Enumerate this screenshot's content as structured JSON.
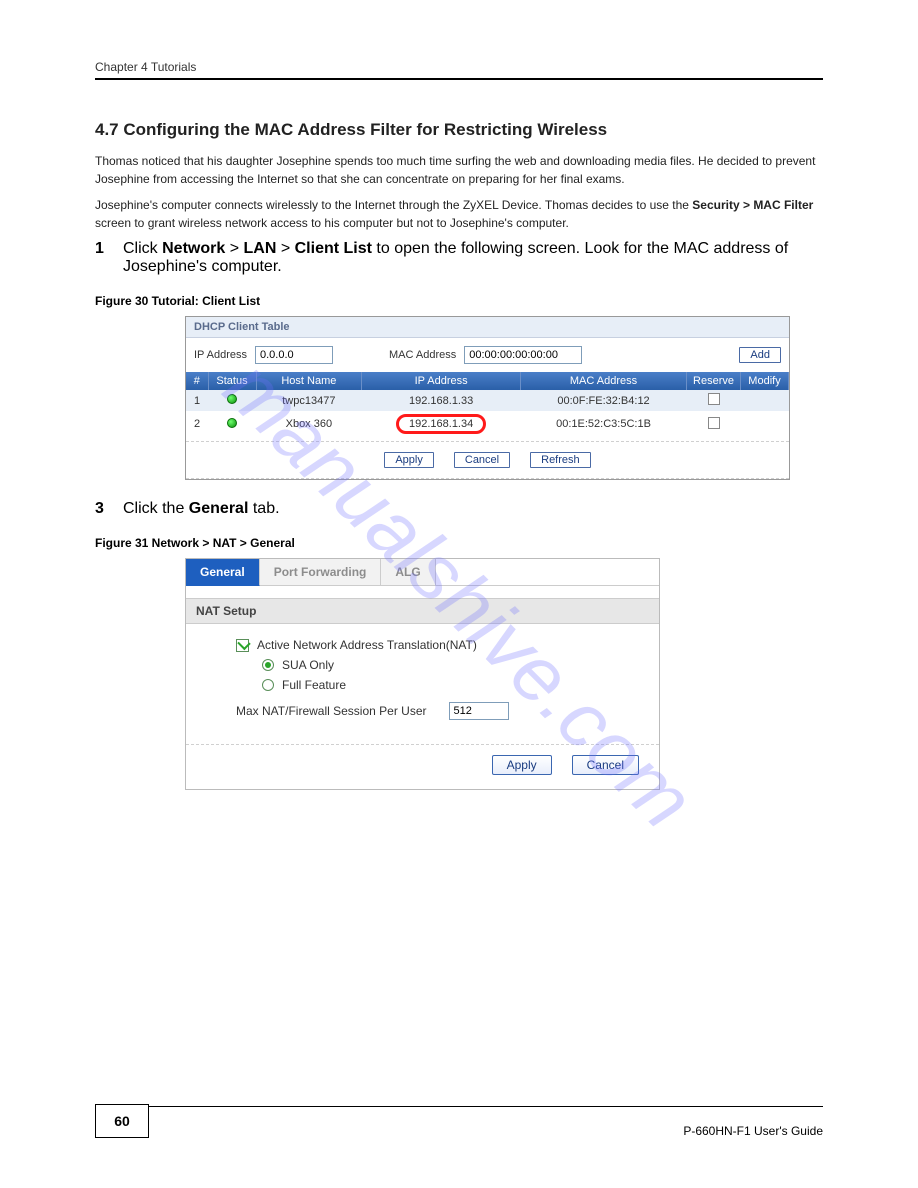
{
  "header": {
    "chapter": "Chapter 4 Tutorials"
  },
  "section_title": "4.7  Configuring the MAC Address Filter for Restricting Wireless",
  "intro1": "Thomas noticed that his daughter Josephine spends too much time surfing the web and downloading media files. He decided to prevent Josephine from accessing the Internet so that she can concentrate on preparing for her final exams.",
  "intro2_prefix": "Josephine's computer connects wirelessly to the Internet through the ZyXEL Device. Thomas decides to use the ",
  "intro2_menu": "Security > MAC Filter",
  "intro2_suffix": " screen to grant wireless network access to his computer but not to Josephine's computer.",
  "step1": {
    "num": "1",
    "text_prefix": "Click ",
    "menu1": "Network",
    "gt": " > ",
    "menu2": "LAN",
    "gt2": " > ",
    "menu3": "Client List",
    "suffix": " to open the following screen. Look for the MAC address of Josephine's computer."
  },
  "figure1_caption": "Figure 30   Tutorial: Client List",
  "dhcp": {
    "title": "DHCP Client Table",
    "ip_label": "IP Address",
    "ip_value": "0.0.0.0",
    "mac_label": "MAC Address",
    "mac_value": "00:00:00:00:00:00",
    "add": "Add",
    "columns": [
      "#",
      "Status",
      "Host Name",
      "IP Address",
      "MAC Address",
      "Reserve",
      "Modify"
    ],
    "rows": [
      {
        "n": "1",
        "host": "twpc13477",
        "ip": "192.168.1.33",
        "mac": "00:0F:FE:32:B4:12",
        "circled": false
      },
      {
        "n": "2",
        "host": "Xbox 360",
        "ip": "192.168.1.34",
        "mac": "00:1E:52:C3:5C:1B",
        "circled": true
      }
    ],
    "apply": "Apply",
    "cancel": "Cancel",
    "refresh": "Refresh"
  },
  "step2": {
    "num": "3",
    "prefix": "Click the ",
    "tab": "General",
    "suffix": " tab."
  },
  "figure2_caption": "Figure 31   Network > NAT > General",
  "nat": {
    "tabs": [
      "General",
      "Port Forwarding",
      "ALG"
    ],
    "section": "NAT Setup",
    "checkbox": "Active Network Address Translation(NAT)",
    "radio1": "SUA Only",
    "radio2": "Full Feature",
    "session_label": "Max NAT/Firewall Session Per User",
    "session_value": "512",
    "apply": "Apply",
    "cancel": "Cancel"
  },
  "footer": {
    "page": "60",
    "manual": "P-660HN-F1 User's Guide"
  },
  "watermark": "manualshive.com"
}
